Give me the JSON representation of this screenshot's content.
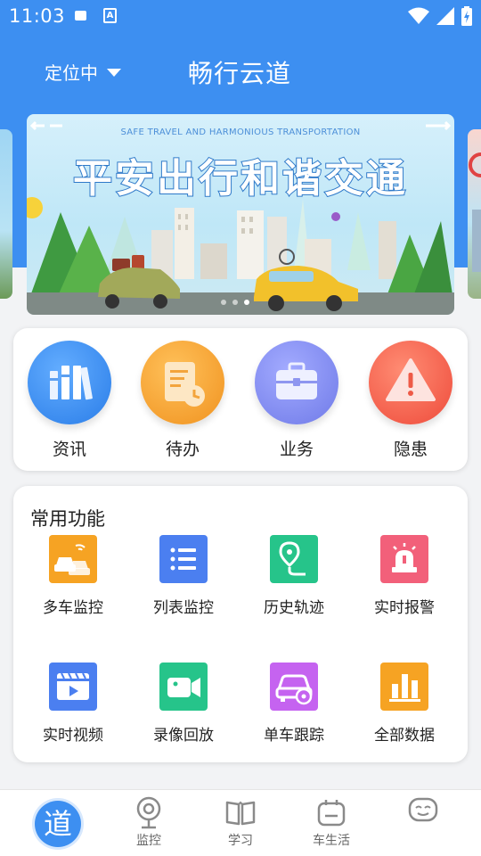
{
  "status_bar": {
    "time": "11:03",
    "notification_badge": "A"
  },
  "header": {
    "location_label": "定位中",
    "app_title": "畅行云道"
  },
  "banner": {
    "subtitle": "SAFE TRAVEL AND HARMONIOUS TRANSPORTATION",
    "title": "平安出行和谐交通",
    "dots": 3,
    "active_dot": 3
  },
  "quick_entries": [
    {
      "label": "资讯",
      "icon": "books-icon",
      "color": "#3a8ef0"
    },
    {
      "label": "待办",
      "icon": "document-clock-icon",
      "color": "#f5a73b"
    },
    {
      "label": "业务",
      "icon": "briefcase-icon",
      "color": "#7f8af0"
    },
    {
      "label": "隐患",
      "icon": "warning-icon",
      "color": "#f2604c"
    }
  ],
  "common_functions": {
    "title": "常用功能",
    "items": [
      {
        "label": "多车监控",
        "icon": "multi-car-icon",
        "color": "#f6a323"
      },
      {
        "label": "列表监控",
        "icon": "list-icon",
        "color": "#4b7ff0"
      },
      {
        "label": "历史轨迹",
        "icon": "route-icon",
        "color": "#26c48a"
      },
      {
        "label": "实时报警",
        "icon": "alarm-light-icon",
        "color": "#f2607a"
      },
      {
        "label": "实时视频",
        "icon": "video-icon",
        "color": "#4b7ff0"
      },
      {
        "label": "录像回放",
        "icon": "camera-icon",
        "color": "#26c48a"
      },
      {
        "label": "单车跟踪",
        "icon": "car-track-icon",
        "color": "#c563f0"
      },
      {
        "label": "全部数据",
        "icon": "bar-chart-icon",
        "color": "#f6a323"
      }
    ]
  },
  "tabbar": {
    "items": [
      {
        "label": "",
        "icon": "dao-icon",
        "glyph": "道",
        "active": true
      },
      {
        "label": "监控",
        "icon": "webcam-icon"
      },
      {
        "label": "学习",
        "icon": "book-icon"
      },
      {
        "label": "车生活",
        "icon": "car-life-icon"
      },
      {
        "label": "",
        "icon": "face-icon"
      }
    ]
  }
}
